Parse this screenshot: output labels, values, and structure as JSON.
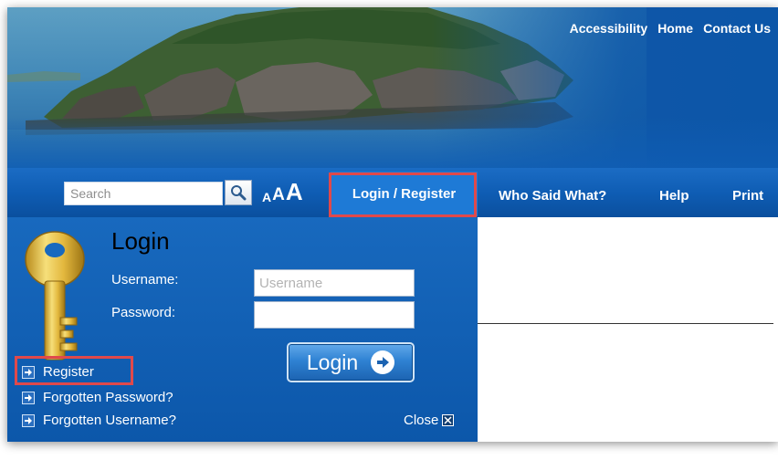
{
  "top_links": [
    "Accessibility",
    "Home",
    "Contact Us"
  ],
  "nav": {
    "search_placeholder": "Search",
    "font_sizes": [
      "A",
      "A",
      "A"
    ],
    "items": [
      "Login / Register",
      "Who Said What?",
      "Help",
      "Print"
    ]
  },
  "login": {
    "title": "Login",
    "username_label": "Username:",
    "password_label": "Password:",
    "username_placeholder": "Username",
    "password_value": "",
    "button_label": "Login",
    "links": [
      "Register",
      "Forgotten Password?",
      "Forgotten Username?"
    ],
    "close_label": "Close"
  },
  "colors": {
    "nav_blue": "#0f5db4",
    "panel_blue": "#1869be",
    "highlight_red": "#e0494b"
  },
  "icons": [
    "search-icon",
    "key-icon",
    "arrow-right-icon",
    "close-icon"
  ]
}
